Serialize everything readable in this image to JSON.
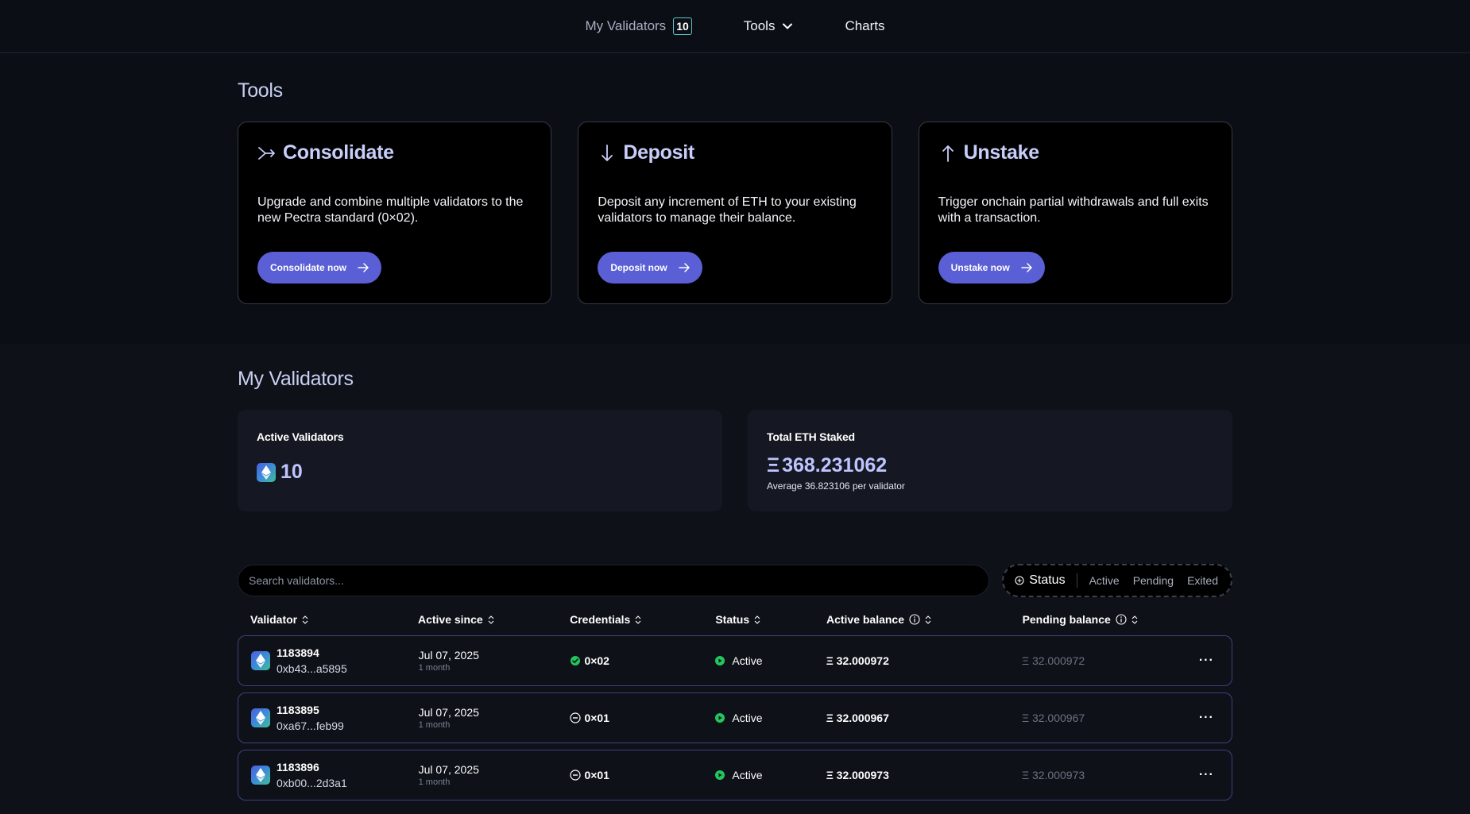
{
  "nav": {
    "my_validators": "My Validators",
    "my_validators_count": "10",
    "tools": "Tools",
    "charts": "Charts"
  },
  "tools_section": {
    "title": "Tools",
    "cards": [
      {
        "icon": "merge-arrows-icon",
        "title": "Consolidate",
        "description": "Upgrade and combine multiple validators to the new Pectra standard (0×02).",
        "button": "Consolidate now"
      },
      {
        "icon": "arrow-down-icon",
        "title": "Deposit",
        "description": "Deposit any increment of ETH to your existing validators to manage their balance.",
        "button": "Deposit now"
      },
      {
        "icon": "arrow-up-icon",
        "title": "Unstake",
        "description": "Trigger onchain partial withdrawals and full exits with a transaction.",
        "button": "Unstake now"
      }
    ]
  },
  "validators_section": {
    "title": "My Validators",
    "active_validators": {
      "label": "Active Validators",
      "value": "10"
    },
    "total_staked": {
      "label": "Total ETH Staked",
      "symbol": "Ξ",
      "value": "368.231062",
      "sub": "Average 36.823106 per validator"
    },
    "search": {
      "placeholder": "Search validators..."
    },
    "filters": {
      "label": "Status",
      "options": [
        "Active",
        "Pending",
        "Exited"
      ]
    },
    "columns": [
      "Validator",
      "Active since",
      "Credentials",
      "Status",
      "Active balance",
      "Pending balance"
    ],
    "rows": [
      {
        "id": "1183894",
        "address": "0xb43...a5895",
        "since": "Jul 07, 2025",
        "since_rel": "1 month",
        "credentials": "0×02",
        "cred_type": "upgraded",
        "status": "Active",
        "active_balance": "Ξ 32.000972",
        "pending_balance": "Ξ 32.000972"
      },
      {
        "id": "1183895",
        "address": "0xa67...feb99",
        "since": "Jul 07, 2025",
        "since_rel": "1 month",
        "credentials": "0×01",
        "cred_type": "legacy",
        "status": "Active",
        "active_balance": "Ξ 32.000967",
        "pending_balance": "Ξ 32.000967"
      },
      {
        "id": "1183896",
        "address": "0xb00...2d3a1",
        "since": "Jul 07, 2025",
        "since_rel": "1 month",
        "credentials": "0×01",
        "cred_type": "legacy",
        "status": "Active",
        "active_balance": "Ξ 32.000973",
        "pending_balance": "Ξ 32.000973"
      }
    ]
  },
  "colors": {
    "accent": "#5a5fd5",
    "title_lavender": "#c8cdf9",
    "status_green": "#22c55e",
    "row_border": "#3e4180"
  }
}
